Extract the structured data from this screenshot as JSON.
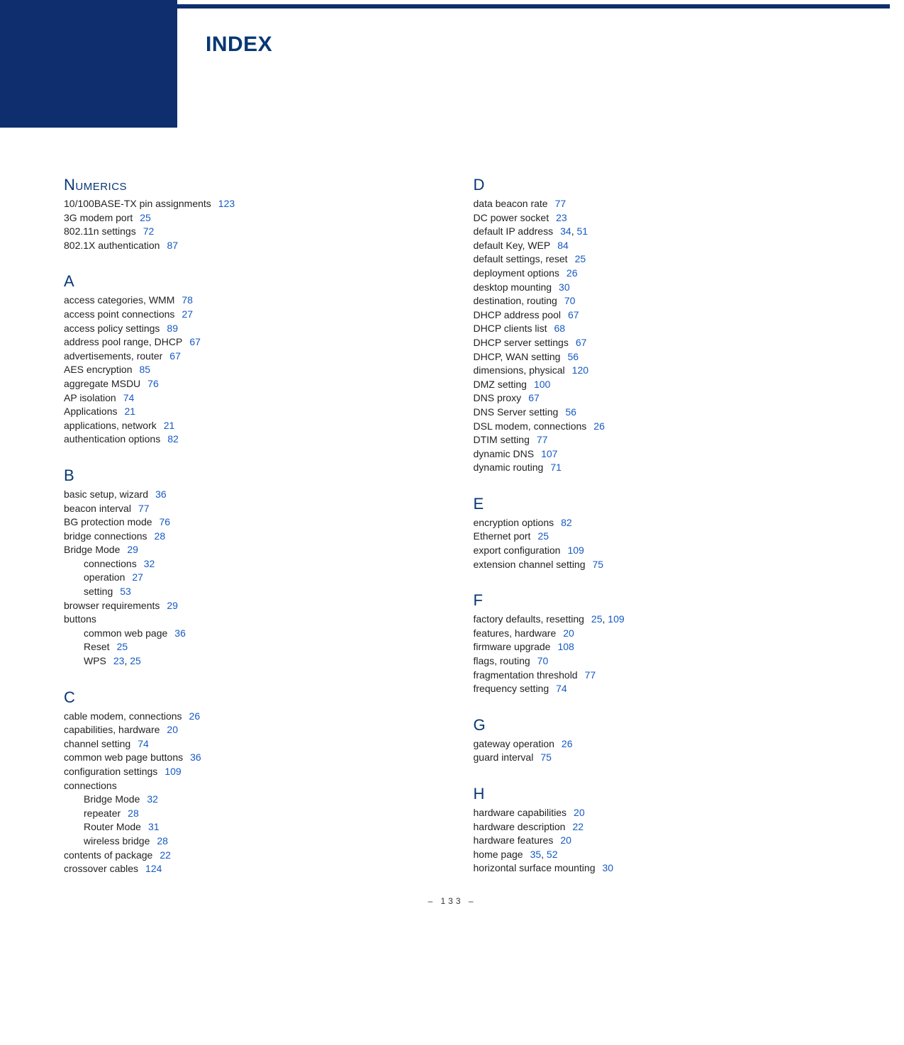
{
  "header": {
    "title": "INDEX"
  },
  "footer": {
    "page_label": "– 133 –"
  },
  "colors": {
    "brand_blue": "#0e2e6e",
    "heading_blue": "#073773",
    "link_blue": "#1559c3"
  },
  "index": {
    "left": [
      {
        "letter": "Numerics",
        "entries": [
          {
            "term": "10/100BASE-TX pin assignments",
            "pages": [
              "123"
            ]
          },
          {
            "term": "3G modem port",
            "pages": [
              "25"
            ]
          },
          {
            "term": "802.11n settings",
            "pages": [
              "72"
            ]
          },
          {
            "term": "802.1X authentication",
            "pages": [
              "87"
            ]
          }
        ]
      },
      {
        "letter": "A",
        "entries": [
          {
            "term": "access categories, WMM",
            "pages": [
              "78"
            ]
          },
          {
            "term": "access point connections",
            "pages": [
              "27"
            ]
          },
          {
            "term": "access policy settings",
            "pages": [
              "89"
            ]
          },
          {
            "term": "address pool range, DHCP",
            "pages": [
              "67"
            ]
          },
          {
            "term": "advertisements, router",
            "pages": [
              "67"
            ]
          },
          {
            "term": "AES encryption",
            "pages": [
              "85"
            ]
          },
          {
            "term": "aggregate MSDU",
            "pages": [
              "76"
            ]
          },
          {
            "term": "AP isolation",
            "pages": [
              "74"
            ]
          },
          {
            "term": "Applications",
            "pages": [
              "21"
            ]
          },
          {
            "term": "applications, network",
            "pages": [
              "21"
            ]
          },
          {
            "term": "authentication options",
            "pages": [
              "82"
            ]
          }
        ]
      },
      {
        "letter": "B",
        "entries": [
          {
            "term": "basic setup, wizard",
            "pages": [
              "36"
            ]
          },
          {
            "term": "beacon interval",
            "pages": [
              "77"
            ]
          },
          {
            "term": "BG protection mode",
            "pages": [
              "76"
            ]
          },
          {
            "term": "bridge connections",
            "pages": [
              "28"
            ]
          },
          {
            "term": "Bridge Mode",
            "pages": [
              "29"
            ]
          },
          {
            "term": "connections",
            "pages": [
              "32"
            ],
            "sub": true
          },
          {
            "term": "operation",
            "pages": [
              "27"
            ],
            "sub": true
          },
          {
            "term": "setting",
            "pages": [
              "53"
            ],
            "sub": true
          },
          {
            "term": "browser requirements",
            "pages": [
              "29"
            ]
          },
          {
            "term": "buttons",
            "pages": []
          },
          {
            "term": "common web page",
            "pages": [
              "36"
            ],
            "sub": true
          },
          {
            "term": "Reset",
            "pages": [
              "25"
            ],
            "sub": true
          },
          {
            "term": "WPS",
            "pages": [
              "23",
              "25"
            ],
            "sub": true
          }
        ]
      },
      {
        "letter": "C",
        "entries": [
          {
            "term": "cable modem, connections",
            "pages": [
              "26"
            ]
          },
          {
            "term": "capabilities, hardware",
            "pages": [
              "20"
            ]
          },
          {
            "term": "channel setting",
            "pages": [
              "74"
            ]
          },
          {
            "term": "common web page buttons",
            "pages": [
              "36"
            ]
          },
          {
            "term": "configuration settings",
            "pages": [
              "109"
            ]
          },
          {
            "term": "connections",
            "pages": []
          },
          {
            "term": "Bridge Mode",
            "pages": [
              "32"
            ],
            "sub": true
          },
          {
            "term": "repeater",
            "pages": [
              "28"
            ],
            "sub": true
          },
          {
            "term": "Router Mode",
            "pages": [
              "31"
            ],
            "sub": true
          },
          {
            "term": "wireless bridge",
            "pages": [
              "28"
            ],
            "sub": true
          },
          {
            "term": "contents of package",
            "pages": [
              "22"
            ]
          },
          {
            "term": "crossover cables",
            "pages": [
              "124"
            ]
          }
        ]
      }
    ],
    "right": [
      {
        "letter": "D",
        "entries": [
          {
            "term": "data beacon rate",
            "pages": [
              "77"
            ]
          },
          {
            "term": "DC power socket",
            "pages": [
              "23"
            ]
          },
          {
            "term": "default IP address",
            "pages": [
              "34",
              "51"
            ]
          },
          {
            "term": "default Key, WEP",
            "pages": [
              "84"
            ]
          },
          {
            "term": "default settings, reset",
            "pages": [
              "25"
            ]
          },
          {
            "term": "deployment options",
            "pages": [
              "26"
            ]
          },
          {
            "term": "desktop mounting",
            "pages": [
              "30"
            ]
          },
          {
            "term": "destination, routing",
            "pages": [
              "70"
            ]
          },
          {
            "term": "DHCP address pool",
            "pages": [
              "67"
            ]
          },
          {
            "term": "DHCP clients list",
            "pages": [
              "68"
            ]
          },
          {
            "term": "DHCP server settings",
            "pages": [
              "67"
            ]
          },
          {
            "term": "DHCP, WAN setting",
            "pages": [
              "56"
            ]
          },
          {
            "term": "dimensions, physical",
            "pages": [
              "120"
            ]
          },
          {
            "term": "DMZ setting",
            "pages": [
              "100"
            ]
          },
          {
            "term": "DNS proxy",
            "pages": [
              "67"
            ]
          },
          {
            "term": "DNS Server setting",
            "pages": [
              "56"
            ]
          },
          {
            "term": "DSL modem, connections",
            "pages": [
              "26"
            ]
          },
          {
            "term": "DTIM setting",
            "pages": [
              "77"
            ]
          },
          {
            "term": "dynamic DNS",
            "pages": [
              "107"
            ]
          },
          {
            "term": "dynamic routing",
            "pages": [
              "71"
            ]
          }
        ]
      },
      {
        "letter": "E",
        "entries": [
          {
            "term": "encryption options",
            "pages": [
              "82"
            ]
          },
          {
            "term": "Ethernet port",
            "pages": [
              "25"
            ]
          },
          {
            "term": "export configuration",
            "pages": [
              "109"
            ]
          },
          {
            "term": "extension channel setting",
            "pages": [
              "75"
            ]
          }
        ]
      },
      {
        "letter": "F",
        "entries": [
          {
            "term": "factory defaults, resetting",
            "pages": [
              "25",
              "109"
            ]
          },
          {
            "term": "features, hardware",
            "pages": [
              "20"
            ]
          },
          {
            "term": "firmware upgrade",
            "pages": [
              "108"
            ]
          },
          {
            "term": "flags, routing",
            "pages": [
              "70"
            ]
          },
          {
            "term": "fragmentation threshold",
            "pages": [
              "77"
            ]
          },
          {
            "term": "frequency setting",
            "pages": [
              "74"
            ]
          }
        ]
      },
      {
        "letter": "G",
        "entries": [
          {
            "term": "gateway operation",
            "pages": [
              "26"
            ]
          },
          {
            "term": "guard interval",
            "pages": [
              "75"
            ]
          }
        ]
      },
      {
        "letter": "H",
        "entries": [
          {
            "term": "hardware capabilities",
            "pages": [
              "20"
            ]
          },
          {
            "term": "hardware description",
            "pages": [
              "22"
            ]
          },
          {
            "term": "hardware features",
            "pages": [
              "20"
            ]
          },
          {
            "term": "home page",
            "pages": [
              "35",
              "52"
            ]
          },
          {
            "term": "horizontal surface mounting",
            "pages": [
              "30"
            ]
          }
        ]
      }
    ]
  }
}
